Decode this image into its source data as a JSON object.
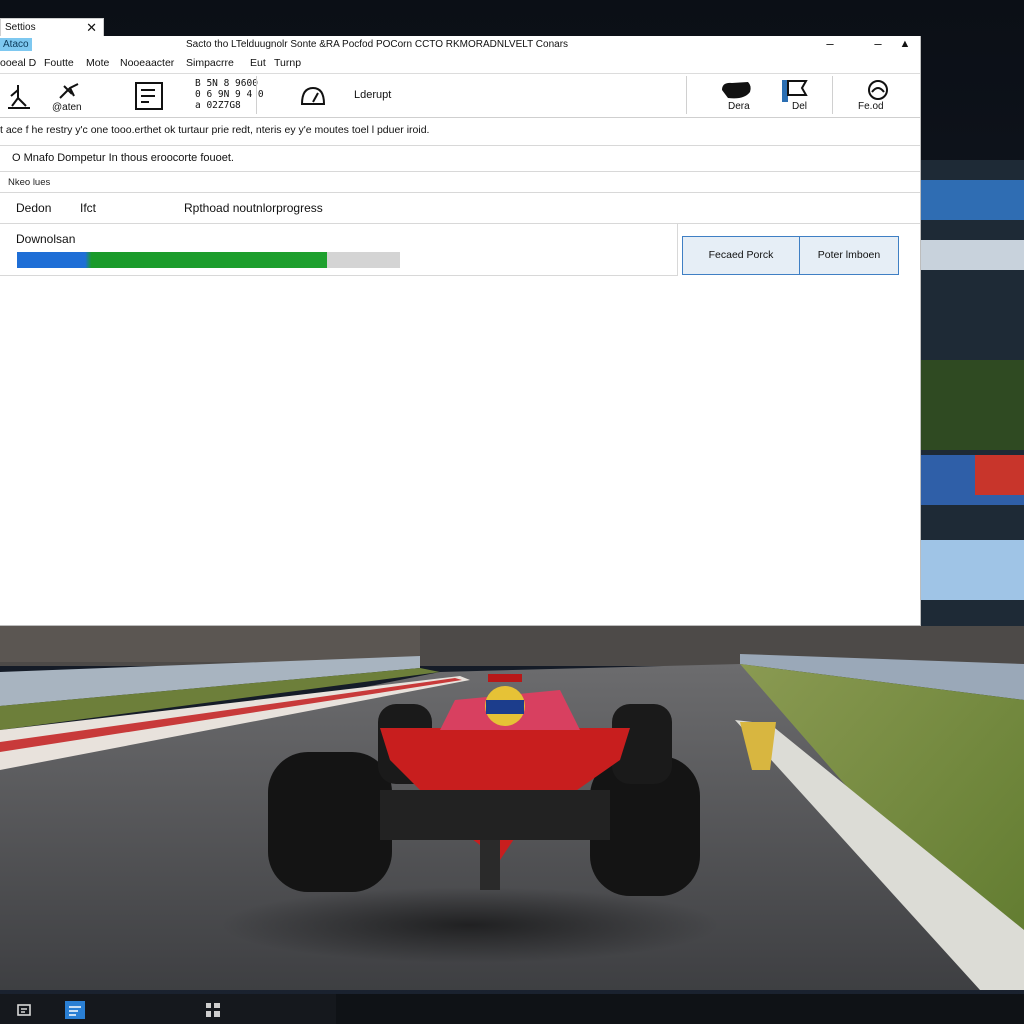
{
  "tab": {
    "label": "Settios"
  },
  "window": {
    "app_badge": "Ataco",
    "title": "Sacto tho LTelduugnolr Sonte &RA Pocfod POCorn CCTO RKMORADNLVELT Conars",
    "controls": [
      "minimize",
      "minimize",
      "up-arrow"
    ]
  },
  "menu": [
    "ooeal D",
    "Foutte",
    "Mote",
    "Nooeaacter",
    "Simpacrre",
    "Eut",
    "Turnp"
  ],
  "toolbar": {
    "left_icon_label": "",
    "gear_label": "@aten",
    "code_lines": [
      "B 5N 8 9600",
      "0 6 9N 9 4 0",
      "a 02Z7G8"
    ],
    "dashboard_label": "Lderupt",
    "right_items": [
      {
        "icon": "camera-icon",
        "label": "Dera"
      },
      {
        "icon": "flag-icon",
        "label": "Del"
      },
      {
        "icon": "record-icon",
        "label": "Fe.od"
      }
    ]
  },
  "info_text": "t ace f he restry y'c one tooo.erthet ok turtaur prie redt, nteris ey y'e moutes toel l pduer iroid.",
  "notice_text": "O Mnafo Dompetur In thous eroocorte fouoet.",
  "section_label": "Nkeo lues",
  "columns": {
    "col1": "Dedon",
    "col2": "Ifct",
    "col3": "Rpthoad noutnlorprogress"
  },
  "download": {
    "label": "Downolsan",
    "progress": 0.81
  },
  "buttons": {
    "primary": "Fecaed Porck",
    "secondary": "Poter lmboen"
  },
  "colors": {
    "progress_blue": "#1e6ed6",
    "progress_green": "#1ea02e",
    "button_border": "#3f7fc4",
    "car_red": "#c81e1e"
  }
}
